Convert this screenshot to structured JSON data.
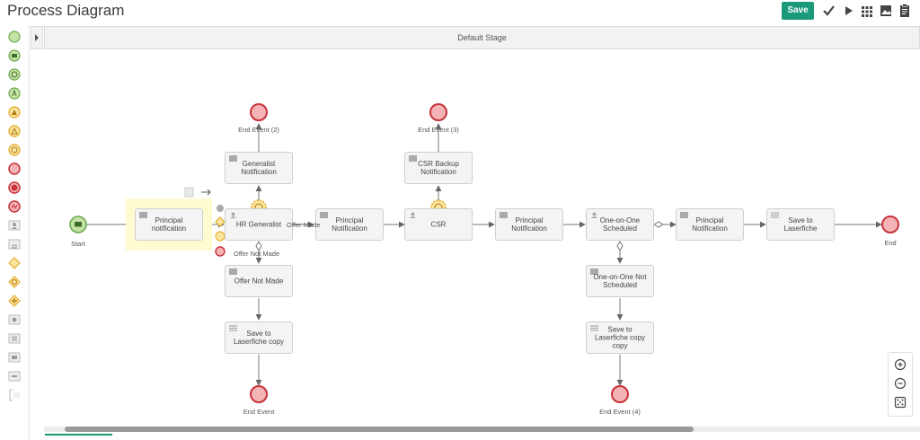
{
  "app": {
    "title": "Process Diagram"
  },
  "toolbar": {
    "save_label": "Save",
    "icons": [
      "check-icon",
      "play-icon",
      "grid-icon",
      "image-icon",
      "clipboard-icon"
    ],
    "accent": "#1a9a78"
  },
  "palette": {
    "items": [
      "start-event-icon",
      "message-start-icon",
      "timer-start-icon",
      "signal-start-icon",
      "escalation-event-icon",
      "intermediate-event-icon",
      "timer-event-icon",
      "end-event-icon",
      "terminate-end-icon",
      "error-end-icon",
      "user-task-icon",
      "sub-process-icon",
      "exclusive-gateway-icon",
      "inclusive-gateway-icon",
      "parallel-gateway-icon",
      "service-task-icon",
      "script-task-icon",
      "message-task-icon",
      "data-icon",
      "annotation-icon"
    ]
  },
  "stage": {
    "title": "Default Stage"
  },
  "diagram": {
    "start_label": "Start",
    "tasks": {
      "principal_notification_1": "Principal notification",
      "hr_generalist": "HR Generalist",
      "generalist_notification": "Generalist Notification",
      "offer_not_made": "Offer Not Made",
      "save_laserfiche_copy": "Save to Laserfiche copy",
      "principal_notification_2": "Principal Notification",
      "csr": "CSR",
      "csr_backup_notification": "CSR Backup Notification",
      "principal_notification_3": "Principal Notification",
      "one_on_one_scheduled": "One-on-One Scheduled",
      "one_on_one_not_scheduled": "One-on-One Not Scheduled",
      "save_laserfiche_copy_copy": "Save to Laserfiche copy copy",
      "principal_notification_4": "Principal Notification",
      "save_to_laserfiche": "Save to Laserfiche"
    },
    "end_events": {
      "end_event_2": "End Event (2)",
      "end_event_3": "End Event (3)",
      "end_event": "End Event",
      "end_event_4": "End Event (4)",
      "end": "End"
    },
    "edge_labels": {
      "offer_made": "Offer Made",
      "offer_not_made": "Offer Not Made"
    },
    "colors": {
      "start_fill": "#c6e3a5",
      "start_stroke": "#6aa84f",
      "end_fill": "#f4b4b6",
      "end_stroke": "#c8323a",
      "selection": "#fffbd0",
      "timer": "#f0c030"
    }
  }
}
